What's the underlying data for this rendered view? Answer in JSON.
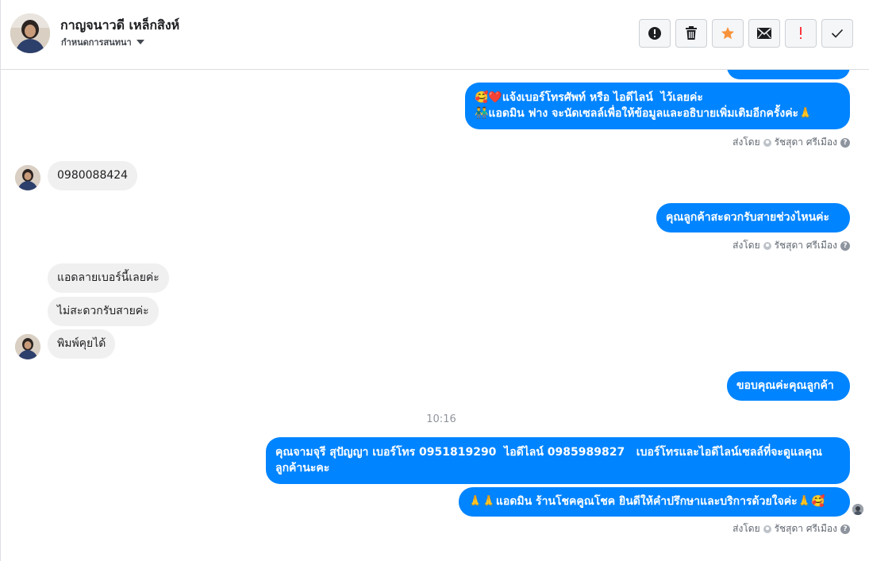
{
  "header": {
    "name": "กาญจนาวดี เหล็กสิงห์",
    "subtitle": "กำหนดการสนทนา"
  },
  "toolbar": {
    "buttons": [
      {
        "icon": "alert-circle-icon",
        "color": "#1c1e21"
      },
      {
        "icon": "trash-icon",
        "color": "#1c1e21"
      },
      {
        "icon": "star-icon",
        "color": "#f7923a"
      },
      {
        "icon": "envelope-icon",
        "color": "#1c1e21"
      },
      {
        "icon": "exclamation-icon",
        "color": "#fa383e"
      },
      {
        "icon": "checkmark-icon",
        "color": "#1c1e21"
      }
    ]
  },
  "messages": {
    "out1": "🥰❤️แจ้งเบอร์โทรศัพท์ หรือ ไอดีไลน์  ไว้เลยค่ะ\n👬แอดมิน ฟาง จะนัดเซลล์เพื่อให้ข้อมูลและอธิบายเพิ่มเติมอีกครั้งค่ะ🙏",
    "in1": "0980088424",
    "out2": "คุณลูกค้าสะดวกรับสายช่วงไหนค่ะ",
    "in2": "แอดลายเบอร์นี้เลยค่ะ",
    "in3": "ไม่สะดวกรับสายค่ะ",
    "in4": "พิมพ์คุยได้",
    "out3": "ขอบคุณค่ะคุณลูกค้า",
    "timestamp": "10:16",
    "out4": "คุณจามจุรี สุปัญญา เบอร์โทร 0951819290  ไอดีไลน์ 0985989827   เบอร์โทรและไอดีไลน์เซลล์ที่จะดูแลคุณลูกค้านะคะ",
    "out5": "🙏🙏แอดมิน ร้านโชคคูณโชค ยินดีให้คำปรึกษาและบริการด้วยใจค่ะ🙏🥰"
  },
  "sent_by": {
    "prefix": "ส่งโดย",
    "name": "รัชสุดา ศรีเมือง"
  }
}
